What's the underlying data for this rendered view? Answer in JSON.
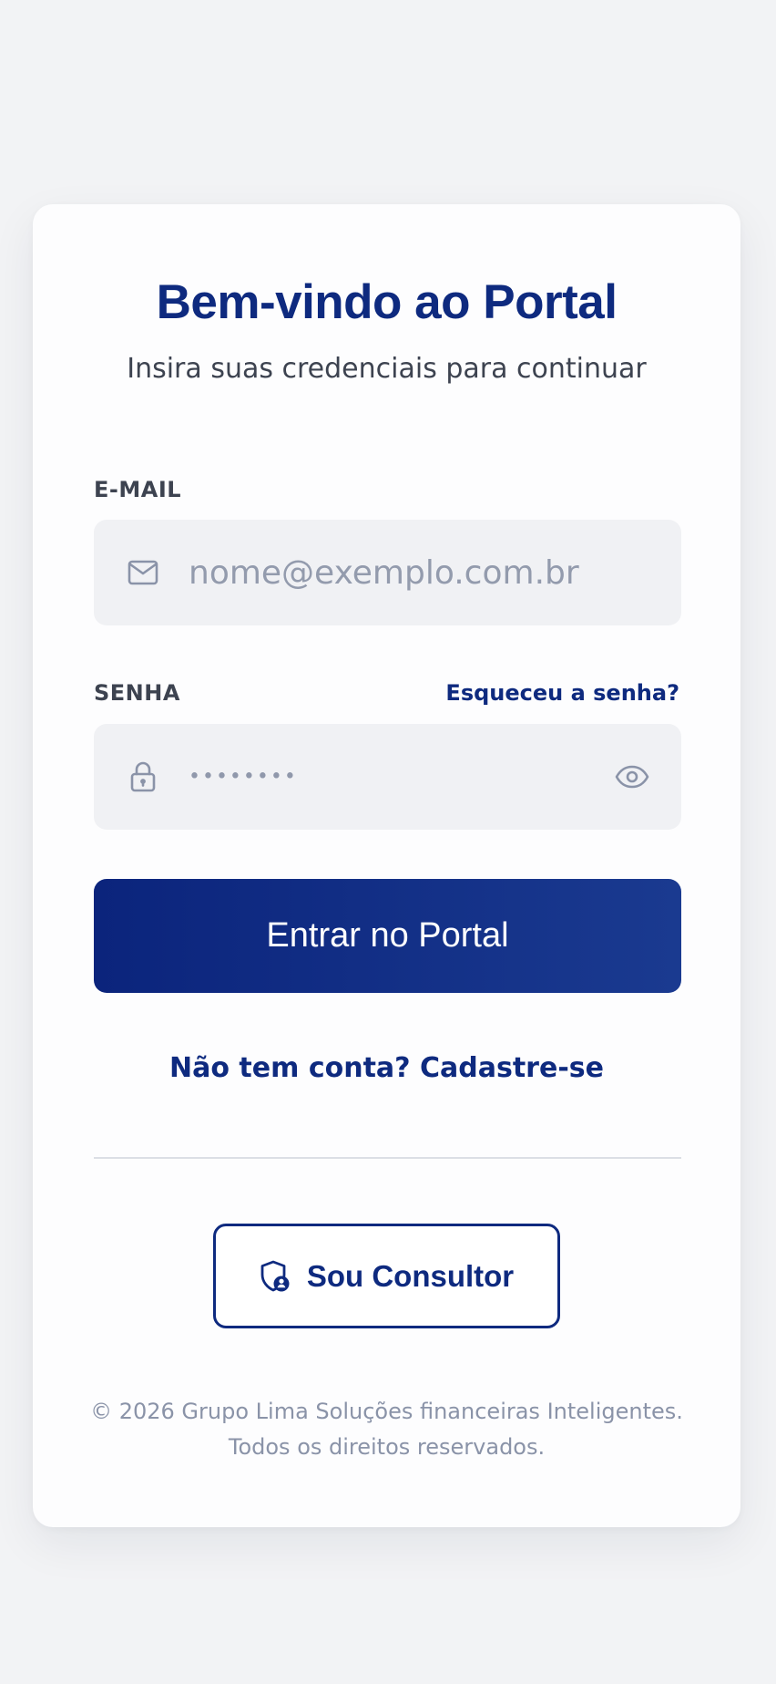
{
  "header": {
    "title": "Bem-vindo ao Portal",
    "subtitle": "Insira suas credenciais para continuar"
  },
  "form": {
    "email": {
      "label": "E-MAIL",
      "placeholder": "nome@exemplo.com.br",
      "icon": "mail-icon"
    },
    "password": {
      "label": "SENHA",
      "masked_value": "••••••••",
      "icon": "lock-icon",
      "toggle_icon": "eye-icon",
      "forgot_link": "Esqueceu a senha?"
    },
    "submit_label": "Entrar no Portal",
    "signup_link": "Não tem conta? Cadastre-se"
  },
  "consultor": {
    "label": "Sou Consultor",
    "icon": "shield-user-icon"
  },
  "footer": {
    "line1": "© 2026 Grupo Lima Soluções financeiras Inteligentes.",
    "line2": "Todos os direitos reservados."
  },
  "colors": {
    "primary": "#0e2a7f",
    "background": "#f2f3f5",
    "card": "#fdfdfe",
    "field": "#f0f1f4",
    "muted": "#8a93a8"
  }
}
